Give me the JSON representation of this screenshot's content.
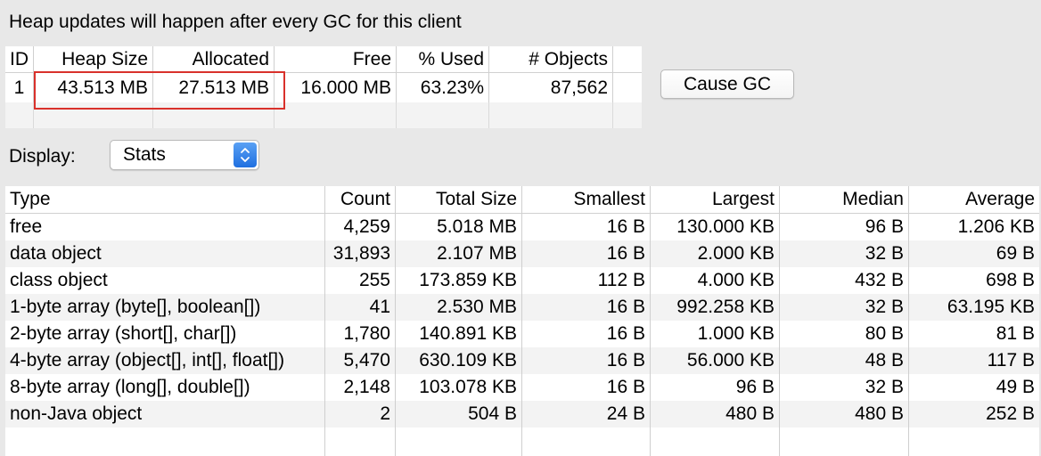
{
  "notice": "Heap updates will happen after every GC for this client",
  "heap_table": {
    "headers": [
      "ID",
      "Heap Size",
      "Allocated",
      "Free",
      "% Used",
      "# Objects"
    ],
    "row": [
      "1",
      "43.513 MB",
      "27.513 MB",
      "16.000 MB",
      "63.23%",
      "87,562"
    ]
  },
  "cause_gc_label": "Cause GC",
  "display": {
    "label": "Display:",
    "selected": "Stats"
  },
  "stats_table": {
    "headers": [
      "Type",
      "Count",
      "Total Size",
      "Smallest",
      "Largest",
      "Median",
      "Average"
    ],
    "rows": [
      [
        "free",
        "4,259",
        "5.018 MB",
        "16 B",
        "130.000 KB",
        "96 B",
        "1.206 KB"
      ],
      [
        "data object",
        "31,893",
        "2.107 MB",
        "16 B",
        "2.000 KB",
        "32 B",
        "69 B"
      ],
      [
        "class object",
        "255",
        "173.859 KB",
        "112 B",
        "4.000 KB",
        "432 B",
        "698 B"
      ],
      [
        "1-byte array (byte[], boolean[])",
        "41",
        "2.530 MB",
        "16 B",
        "992.258 KB",
        "32 B",
        "63.195 KB"
      ],
      [
        "2-byte array (short[], char[])",
        "1,780",
        "140.891 KB",
        "16 B",
        "1.000 KB",
        "80 B",
        "81 B"
      ],
      [
        "4-byte array (object[], int[], float[])",
        "5,470",
        "630.109 KB",
        "16 B",
        "56.000 KB",
        "48 B",
        "117 B"
      ],
      [
        "8-byte array (long[], double[])",
        "2,148",
        "103.078 KB",
        "16 B",
        "96 B",
        "32 B",
        "49 B"
      ],
      [
        "non-Java object",
        "2",
        "504 B",
        "24 B",
        "480 B",
        "480 B",
        "252 B"
      ]
    ]
  },
  "colors": {
    "highlight": "#d9312b",
    "stepper": "#2f7fe8"
  }
}
